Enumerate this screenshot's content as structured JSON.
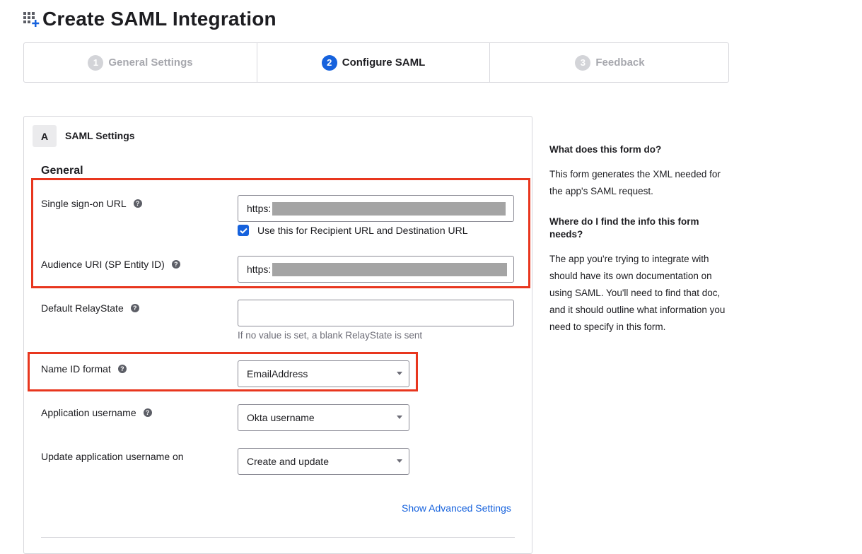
{
  "header": {
    "title": "Create SAML Integration",
    "icon": "app-grid-add-icon",
    "icon_accent": "#1662dd"
  },
  "wizard": {
    "steps": [
      {
        "number": "1",
        "label": "General Settings",
        "state": "inactive"
      },
      {
        "number": "2",
        "label": "Configure SAML",
        "state": "active"
      },
      {
        "number": "3",
        "label": "Feedback",
        "state": "inactive"
      }
    ]
  },
  "section": {
    "badge": "A",
    "title": "SAML Settings",
    "group": "General",
    "sso_url": {
      "label": "Single sign-on URL",
      "value": "https:",
      "checkbox_label": "Use this for Recipient URL and Destination URL",
      "checkbox_checked": true
    },
    "audience_uri": {
      "label": "Audience URI (SP Entity ID)",
      "value": "https:"
    },
    "relay_state": {
      "label": "Default RelayState",
      "value": "",
      "hint": "If no value is set, a blank RelayState is sent"
    },
    "name_id_format": {
      "label": "Name ID format",
      "value": "EmailAddress"
    },
    "app_username": {
      "label": "Application username",
      "value": "Okta username"
    },
    "update_username": {
      "label": "Update application username on",
      "value": "Create and update"
    },
    "advanced_link": "Show Advanced Settings"
  },
  "aside": {
    "q1": "What does this form do?",
    "a1": "This form generates the XML needed for the app's SAML request.",
    "q2": "Where do I find the info this form needs?",
    "a2": "The app you're trying to integrate with should have its own documentation on using SAML. You'll need to find that doc, and it should outline what information you need to specify in this form."
  },
  "colors": {
    "accent": "#1662dd",
    "highlight": "#e8361e",
    "redaction": "#a4a4a4"
  }
}
